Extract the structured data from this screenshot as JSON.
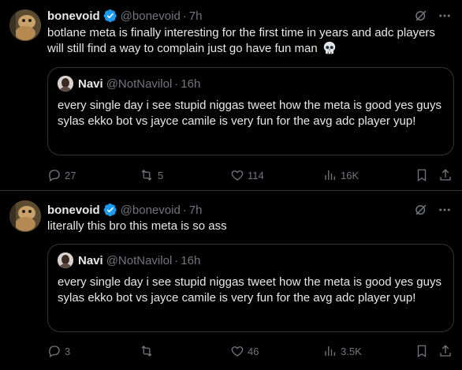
{
  "tweets": [
    {
      "author": {
        "name": "bonevoid",
        "handle": "@bonevoid",
        "time": "7h"
      },
      "text": "botlane meta is finally interesting for the first time in years and adc players will still find a way to complain just go have fun man",
      "quote": {
        "author": {
          "name": "Navi",
          "handle": "@NotNavilol",
          "time": "16h"
        },
        "text": "every single day i see stupid niggas tweet how the meta is good yes guys sylas ekko bot vs jayce camile is very fun for the avg adc player yup!"
      },
      "stats": {
        "replies": "27",
        "reposts": "5",
        "likes": "114",
        "views": "16K"
      }
    },
    {
      "author": {
        "name": "bonevoid",
        "handle": "@bonevoid",
        "time": "7h"
      },
      "text": "literally this bro this meta is so ass",
      "quote": {
        "author": {
          "name": "Navi",
          "handle": "@NotNavilol",
          "time": "16h"
        },
        "text": "every single day i see stupid niggas tweet how the meta is good yes guys sylas ekko bot vs jayce camile is very fun for the avg adc player yup!"
      },
      "stats": {
        "replies": "3",
        "reposts": "",
        "likes": "46",
        "views": "3.5K"
      }
    }
  ],
  "separator": "·",
  "icons": [
    "verified-badge-icon",
    "grok-icon",
    "more-icon",
    "skull-emoji-icon",
    "reply-icon",
    "repost-icon",
    "like-icon",
    "views-icon",
    "bookmark-icon",
    "share-icon"
  ],
  "colors": {
    "background": "#000000",
    "text": "#e7e9ea",
    "muted": "#71767b",
    "verified": "#1d9bf0",
    "border": "#2f3336"
  }
}
